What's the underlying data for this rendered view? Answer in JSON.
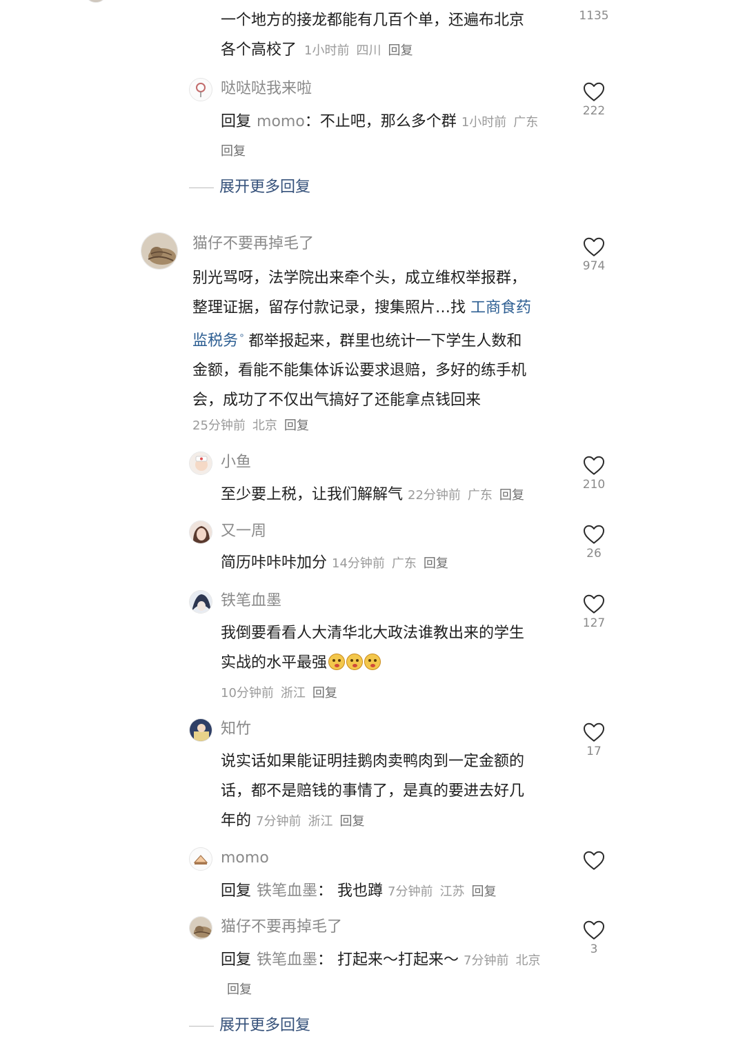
{
  "likes_partial_top": "1135",
  "thread1": {
    "partial_body_l1": "一个地方的接龙都能有几百个单，还遍布北京",
    "partial_body_l2": "各个高校了",
    "partial_time": "1小时前",
    "partial_place": "四川",
    "partial_reply": "回复",
    "reply1": {
      "user": "哒哒哒我来啦",
      "prefix": "回复",
      "target": "momo",
      "text": "：不止吧，那么多个群",
      "time": "1小时前",
      "place": "广东",
      "reply_label": "回复",
      "likes": "222"
    },
    "expand": "展开更多回复"
  },
  "comment2": {
    "user": "猫仔不要再掉毛了",
    "likes": "974",
    "body_l1": "别光骂呀，法学院出来牵个头，成立维权举报群，",
    "body_l2a": "整理证据，留存付款记录，搜集照片…找 ",
    "link_l2": "工商食药",
    "link_l3": "监税务",
    "body_l3b": " 都举报起来，群里也统计一下学生人数和",
    "body_l4": "金额，看能不能集体诉讼要求退赔，多好的练手机",
    "body_l5": "会，成功了不仅出气搞好了还能拿点钱回来",
    "time": "25分钟前",
    "place": "北京",
    "reply_label": "回复",
    "replies": [
      {
        "user": "小鱼",
        "text": "至少要上税，让我们解解气",
        "time": "22分钟前",
        "place": "广东",
        "reply_label": "回复",
        "likes": "210"
      },
      {
        "user": "又一周",
        "text": "简历咔咔咔加分",
        "time": "14分钟前",
        "place": "广东",
        "reply_label": "回复",
        "likes": "26"
      },
      {
        "user": "铁笔血墨",
        "text_l1": "我倒要看看人大清华北大政法谁教出来的学生",
        "text_l2": "实战的水平最强",
        "time": "10分钟前",
        "place": "浙江",
        "reply_label": "回复",
        "likes": "127"
      },
      {
        "user": "知竹",
        "text_l1": "说实话如果能证明挂鹅肉卖鸭肉到一定金额的",
        "text_l2": "话，都不是赔钱的事情了，是真的要进去好几",
        "text_l3": "年的",
        "time": "7分钟前",
        "place": "浙江",
        "reply_label": "回复",
        "likes": "17"
      },
      {
        "user": "momo",
        "prefix": "回复",
        "target": "铁笔血墨",
        "text": "：  我也蹲",
        "time": "7分钟前",
        "place": "江苏",
        "reply_label": "回复",
        "likes": ""
      },
      {
        "user": "猫仔不要再掉毛了",
        "prefix": "回复",
        "target": "铁笔血墨",
        "text": "：  打起来～打起来～",
        "time": "7分钟前",
        "place": "北京",
        "reply_label": "回复",
        "likes": "3"
      }
    ],
    "expand": "展开更多回复"
  },
  "icons": {
    "like": "heart-outline-icon",
    "link_search": "search-icon",
    "emoji": "dog-face-emoji"
  }
}
